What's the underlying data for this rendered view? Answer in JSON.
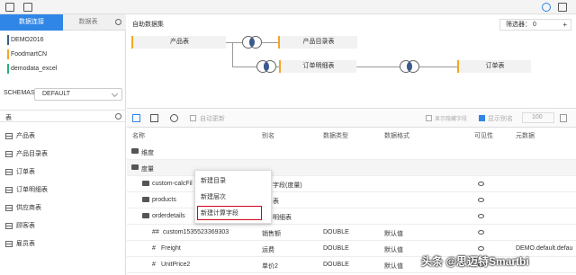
{
  "topbar": {
    "icons": [
      "save-icon",
      "table-icon",
      "refresh-icon",
      "help-icon",
      "fullscreen-icon"
    ]
  },
  "left": {
    "tabs": {
      "active": "数据连接",
      "inactive": "数据表"
    },
    "datasources": [
      {
        "label": "DEMO2016",
        "color": "#3b5b8c"
      },
      {
        "label": "FoodmartCN",
        "color": "#f5a623"
      },
      {
        "label": "demodata_excel",
        "color": "#2ab27b"
      }
    ],
    "schemas_label": "SCHEMAS",
    "schemas_value": "DEFAULT",
    "table_section": "表",
    "tables": [
      "产品表",
      "产品目录表",
      "订单表",
      "订单明细表",
      "供应商表",
      "顾客表",
      "雇员表"
    ]
  },
  "diagram": {
    "title": "自助数据集",
    "filter_label": "筛选器：",
    "filter_count": "0",
    "nodes": {
      "n1": "产品表",
      "n2": "产品目录表",
      "n3": "订单明细表",
      "n4": "订单表"
    }
  },
  "fields_toolbar": {
    "auto_update": "自动更新",
    "show_hidden": "显示隐藏字段",
    "show_alias": "显示别名",
    "alias_value": "100"
  },
  "grid": {
    "headers": {
      "name": "名称",
      "alias": "别名",
      "type": "数据类型",
      "format": "数据格式",
      "visible": "可见性",
      "meta": "元数据"
    },
    "rows": [
      {
        "name": "维度",
        "alias": "",
        "type": "",
        "format": "",
        "meta": ""
      },
      {
        "name": "度量",
        "alias": "",
        "type": "",
        "format": "",
        "meta": ""
      },
      {
        "name": "custom-calcFil",
        "alias": "字段(度量)",
        "type": "",
        "format": "",
        "meta": ""
      },
      {
        "name": "products",
        "alias": "表",
        "type": "",
        "format": "",
        "meta": ""
      },
      {
        "name": "orderdetails",
        "alias": "明细表",
        "type": "",
        "format": "",
        "meta": ""
      },
      {
        "name": "custom1535523369303",
        "alias": "销售额",
        "type": "DOUBLE",
        "format": "默认值",
        "meta": ""
      },
      {
        "name": "Freight",
        "alias": "运费",
        "type": "DOUBLE",
        "format": "默认值",
        "meta": "DEMO.default.defau"
      },
      {
        "name": "UnitPrice2",
        "alias": "单价2",
        "type": "DOUBLE",
        "format": "默认值",
        "meta": ""
      }
    ]
  },
  "context_menu": {
    "items": [
      "新建目录",
      "新建层次",
      "新建计算字段"
    ]
  },
  "watermark": "头条 @思迈特Smartbi"
}
